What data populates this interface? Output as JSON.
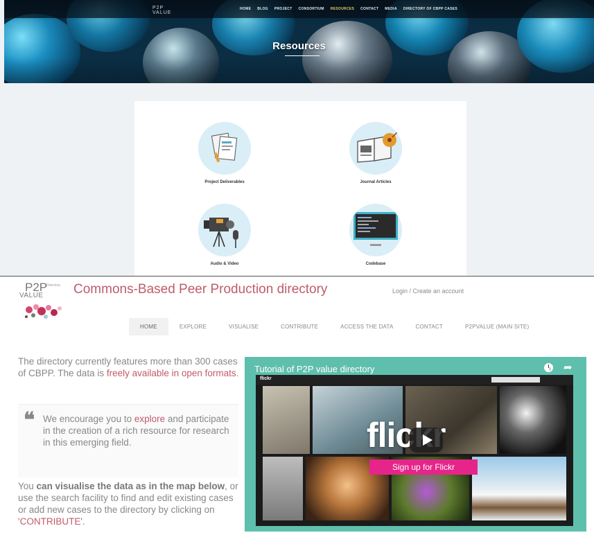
{
  "top": {
    "logo": "P2P\nVALUE",
    "nav": [
      {
        "label": "HOME"
      },
      {
        "label": "BLOG"
      },
      {
        "label": "PROJECT"
      },
      {
        "label": "CONSORTIUM"
      },
      {
        "label": "RESOURCES",
        "active": true
      },
      {
        "label": "CONTACT"
      },
      {
        "label": "MEDIA"
      },
      {
        "label": "DIRECTORY OF CBPP CASES"
      }
    ],
    "hero_title": "Resources",
    "resources": [
      {
        "label": "Project Deliverables",
        "icon": "documents-icon"
      },
      {
        "label": "Journal Articles",
        "icon": "open-book-icon"
      },
      {
        "label": "Audio & Video",
        "icon": "video-camera-icon"
      },
      {
        "label": "Codebase",
        "icon": "code-screen-icon"
      }
    ]
  },
  "bottom": {
    "logo": {
      "p2p": "P2P",
      "value": "VALUE",
      "tag": "Directory"
    },
    "site_title": "Commons-Based Peer Production directory",
    "login": "Login / Create an account",
    "nav": [
      {
        "label": "HOME",
        "active": true
      },
      {
        "label": "EXPLORE"
      },
      {
        "label": "VISUALISE"
      },
      {
        "label": "CONTRIBUTE"
      },
      {
        "label": "ACCESS THE DATA"
      },
      {
        "label": "CONTACT"
      },
      {
        "label": "P2PVALUE (MAIN SITE)"
      }
    ],
    "intro": {
      "text": "The directory currently features more than 300 cases of CBPP. The data is ",
      "link": "freely available in open formats",
      "end": "."
    },
    "quote": {
      "mark": "❝",
      "pre": "We encourage you to ",
      "link": "explore",
      "post": " and participate in the creation of a rich resource for research in this emerging field."
    },
    "visual": {
      "pre": "You ",
      "bold": "can visualise the data as in the map below",
      "mid": ", or use the search facility to find and edit existing cases or add new cases to the directory by clicking on ",
      "link": "'CONTRIBUTE'",
      "end": "."
    },
    "video": {
      "title": "Tutorial of P2P value directory",
      "brand": "flickr",
      "bar_logo": "flickr",
      "signup": "Sign up for Flickr"
    }
  },
  "colors": {
    "accent_pink": "#c05b6a",
    "video_bg": "#5fbfad",
    "flickr_pink": "#e6258a"
  }
}
